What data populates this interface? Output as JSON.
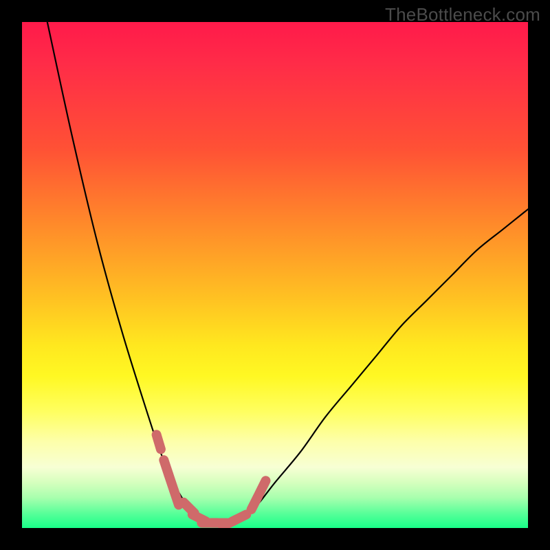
{
  "watermark": {
    "text": "TheBottleneck.com"
  },
  "colors": {
    "background": "#000000",
    "curve_stroke": "#000000",
    "marker_stroke": "#cf6a6a",
    "gradient_stops": [
      "#ff1a4a",
      "#ff2b48",
      "#ff5135",
      "#ff8a2a",
      "#ffc322",
      "#ffe81f",
      "#fff823",
      "#ffff60",
      "#fdffab",
      "#f7ffd4",
      "#d6ffbe",
      "#a8ffae",
      "#5bff9a",
      "#18ff88"
    ]
  },
  "chart_data": {
    "type": "line",
    "title": "",
    "xlabel": "",
    "ylabel": "",
    "xlim": [
      0,
      100
    ],
    "ylim": [
      0,
      100
    ],
    "grid": false,
    "legend": false,
    "series": [
      {
        "name": "bottleneck-curve",
        "x": [
          5,
          10,
          15,
          20,
          25,
          27,
          29,
          31,
          33,
          35,
          37,
          39,
          41,
          43,
          46,
          50,
          55,
          60,
          65,
          70,
          75,
          80,
          85,
          90,
          95,
          100
        ],
        "y": [
          100,
          77,
          56,
          38,
          22,
          16,
          11,
          7,
          4,
          2,
          1,
          1,
          1,
          2,
          4,
          9,
          15,
          22,
          28,
          34,
          40,
          45,
          50,
          55,
          59,
          63
        ]
      }
    ],
    "markers": [
      {
        "name": "left-cluster",
        "x": [
          27.0,
          28.5,
          29.5,
          30.5
        ],
        "y": [
          17,
          12,
          9,
          6
        ]
      },
      {
        "name": "bottom-cluster",
        "x": [
          33,
          35,
          37,
          39,
          41,
          43
        ],
        "y": [
          4,
          2,
          1,
          1,
          1,
          2
        ]
      },
      {
        "name": "right-cluster",
        "x": [
          46,
          47.5
        ],
        "y": [
          5,
          8
        ]
      }
    ]
  }
}
